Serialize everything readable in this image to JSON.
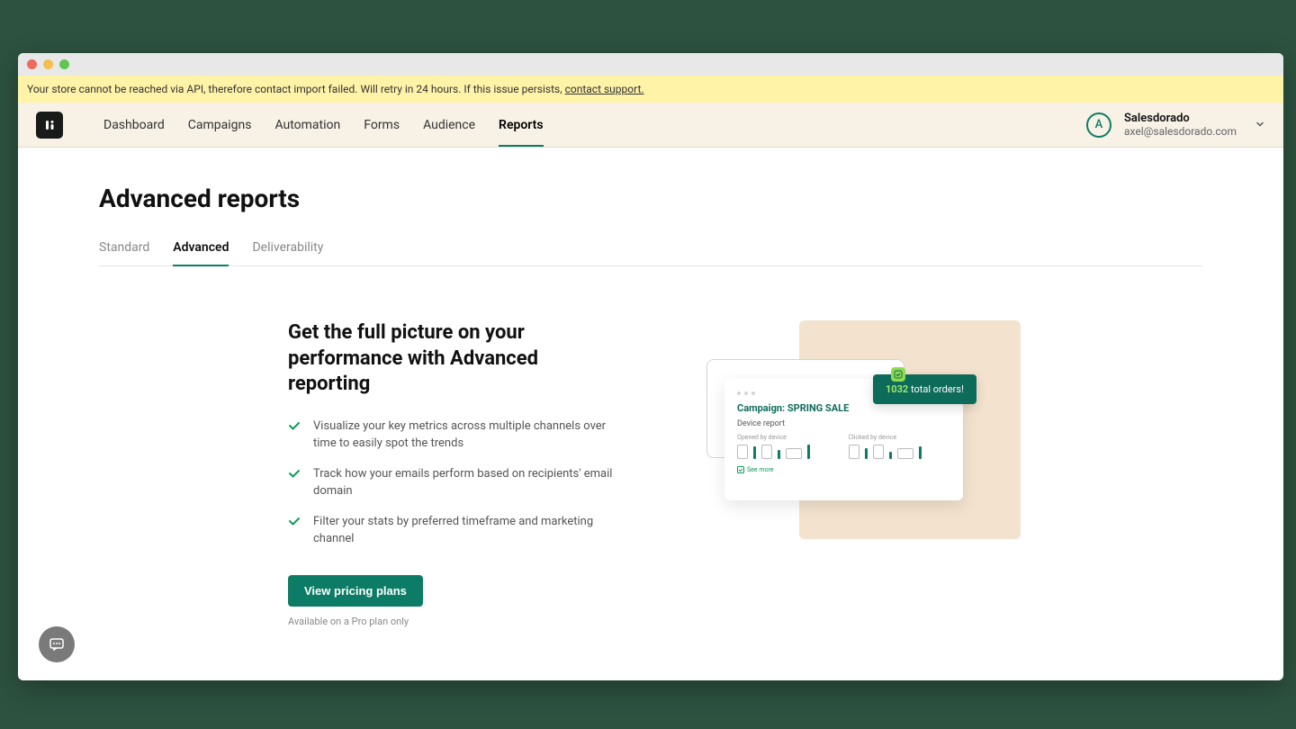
{
  "banner": {
    "text": "Your store cannot be reached via API, therefore contact import failed. Will retry in 24 hours. If this issue persists, ",
    "link": "contact support."
  },
  "nav": {
    "items": [
      "Dashboard",
      "Campaigns",
      "Automation",
      "Forms",
      "Audience",
      "Reports"
    ],
    "active": "Reports"
  },
  "account": {
    "initial": "A",
    "name": "Salesdorado",
    "email": "axel@salesdorado.com"
  },
  "page": {
    "title": "Advanced reports",
    "tabs": [
      "Standard",
      "Advanced",
      "Deliverability"
    ],
    "active_tab": "Advanced"
  },
  "hero": {
    "heading": "Get the full picture on your performance with Advanced reporting",
    "bullets": [
      "Visualize your key metrics across multiple channels over time to easily spot the trends",
      "Track how your emails perform based on recipients' email domain",
      "Filter your stats by preferred timeframe and marketing channel"
    ],
    "button": "View pricing plans",
    "note": "Available on a Pro plan only"
  },
  "illustration": {
    "campaign_label": "Campaign: SPRING SALE",
    "report_label": "Device report",
    "opened_label": "Opened by device",
    "clicked_label": "Clicked by device",
    "see_more": "See more",
    "toast_number": "1032",
    "toast_rest": " total orders!"
  }
}
